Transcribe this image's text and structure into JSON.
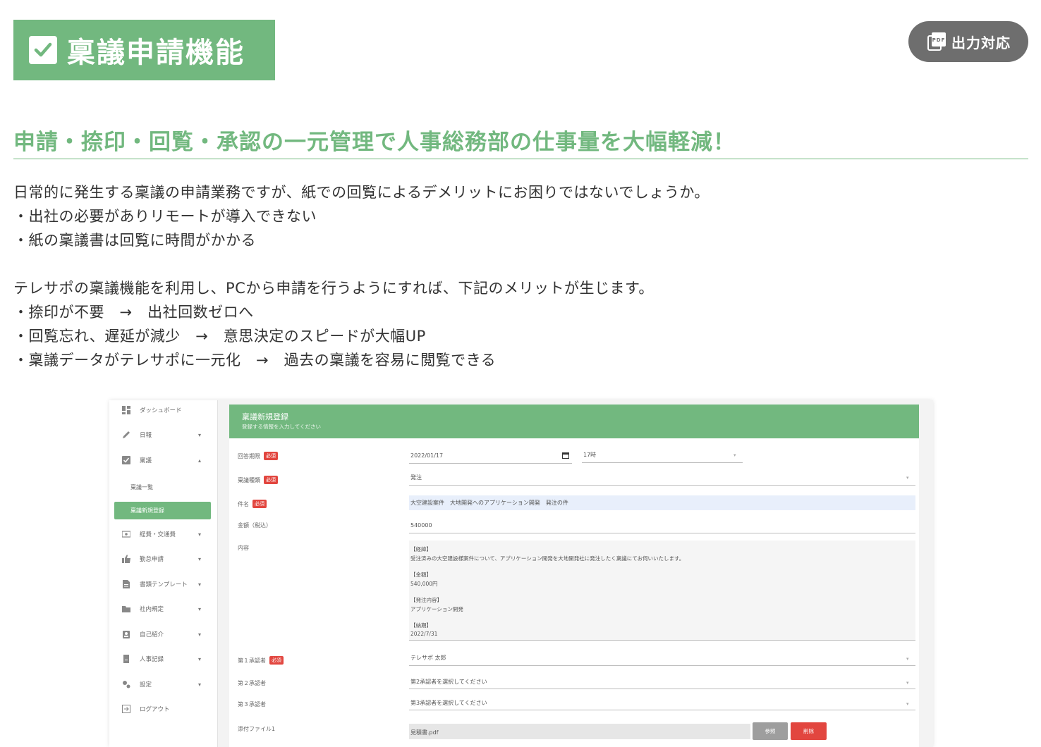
{
  "header": {
    "title": "稟議申請機能",
    "pdf_badge": "出力対応",
    "pdf_icon_text": "PDF"
  },
  "subheading": "申請・捺印・回覧・承認の一元管理で人事総務部の仕事量を大幅軽減！",
  "description": {
    "intro": "日常的に発生する稟議の申請業務ですが、紙での回覧によるデメリットにお困りではないでしょうか。",
    "problems": [
      "・出社の必要がありリモートが導入できない",
      "・紙の稟議書は回覧に時間がかかる"
    ],
    "solution_intro": "テレサポの稟議機能を利用し、PCから申請を行うようにすれば、下記のメリットが生じます。",
    "benefits": [
      "・捺印が不要　→　出社回数ゼロへ",
      "・回覧忘れ、遅延が減少　→　意思決定のスピードが大幅UP",
      "・稟議データがテレサポに一元化　→　過去の稟議を容易に閲覧できる"
    ]
  },
  "app": {
    "sidebar": [
      {
        "label": "ダッシュボード",
        "icon": "dashboard-icon",
        "caret": ""
      },
      {
        "label": "日報",
        "icon": "pencil-icon",
        "caret": "▾"
      },
      {
        "label": "稟議",
        "icon": "checkbox-icon",
        "caret": "▴"
      },
      {
        "label": "経費・交通費",
        "icon": "money-icon",
        "caret": "▾"
      },
      {
        "label": "勤怠申請",
        "icon": "thumbs-up-icon",
        "caret": "▾"
      },
      {
        "label": "書類テンプレート",
        "icon": "document-icon",
        "caret": "▾"
      },
      {
        "label": "社内規定",
        "icon": "folder-icon",
        "caret": "▾"
      },
      {
        "label": "自己紹介",
        "icon": "badge-icon",
        "caret": "▾"
      },
      {
        "label": "人事記録",
        "icon": "record-icon",
        "caret": "▾"
      },
      {
        "label": "設定",
        "icon": "gears-icon",
        "caret": "▾"
      },
      {
        "label": "ログアウト",
        "icon": "logout-icon",
        "caret": ""
      }
    ],
    "sidebar_sub": {
      "list": "稟議一覧",
      "new": "稟議新規登録"
    },
    "form": {
      "title": "稟議新規登録",
      "subtitle": "登録する情報を入力してください",
      "required_label": "必須",
      "deadline_label": "回答期限",
      "deadline_date": "2022/01/17",
      "deadline_time": "17時",
      "type_label": "稟議種類",
      "type_value": "発注",
      "subject_label": "件名",
      "subject_value": "大空建設案件　大地開発へのアプリケーション開発　発注の件",
      "amount_label": "金額（税込）",
      "amount_value": "540000",
      "content_label": "内容",
      "content_lines": [
        "【経緯】",
        "受注済みの大空建設様案件について、アプリケーション開発を大地開発社に発注したく稟議にてお伺いいたします。",
        "【金額】",
        "540,000円",
        "【発注内容】",
        "アプリケーション開発",
        "【納期】",
        "2022/7/31"
      ],
      "approver1_label": "第１承認者",
      "approver1_value": "テレサポ 太郎",
      "approver2_label": "第２承認者",
      "approver2_value": "第2承認者を選択してください",
      "approver3_label": "第３承認者",
      "approver3_value": "第3承認者を選択してください",
      "attachment_label": "添付ファイル1",
      "attachment_value": "見積書.pdf",
      "browse_button": "参照",
      "delete_button": "削除"
    }
  },
  "colors": {
    "accent": "#72b87f",
    "danger": "#e2463f",
    "badge_bg": "#6e6e6e"
  }
}
